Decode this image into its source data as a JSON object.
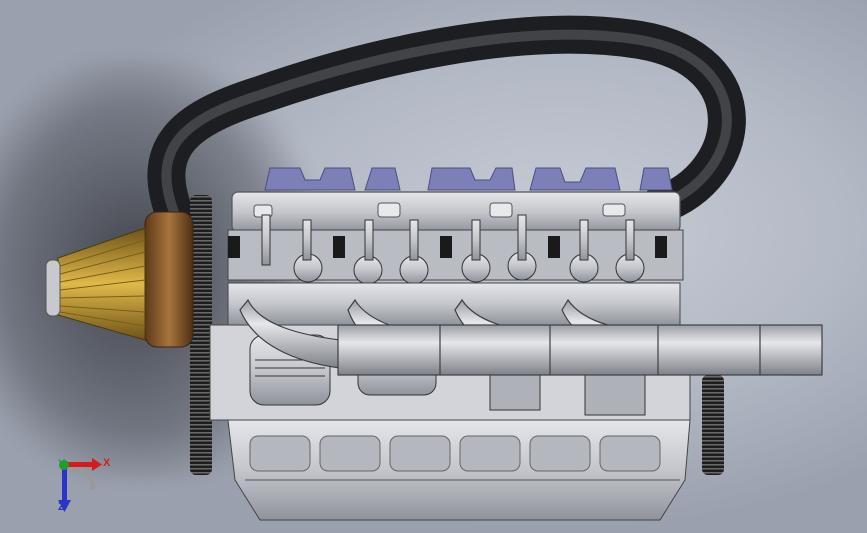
{
  "viewport": {
    "background_colors": [
      "#c7ccd6",
      "#9aa0ad"
    ]
  },
  "model": {
    "part_colors": {
      "breather_hose": "#2b2c2f",
      "air_filter_element": "#c9a23a",
      "filter_housing": "#8a5a2c",
      "cam_lobes": "#7c7fb8",
      "engine_metal": "#c4c6cc",
      "exhaust_pipe": "#bfc1c6",
      "pulley": "#2a2a2a"
    }
  },
  "triad": {
    "x_label": "X",
    "y_label": "Y",
    "z_label": "Z",
    "x_color": "#d41c1c",
    "y_color": "#1f9e2e",
    "z_color": "#2a35c8"
  }
}
